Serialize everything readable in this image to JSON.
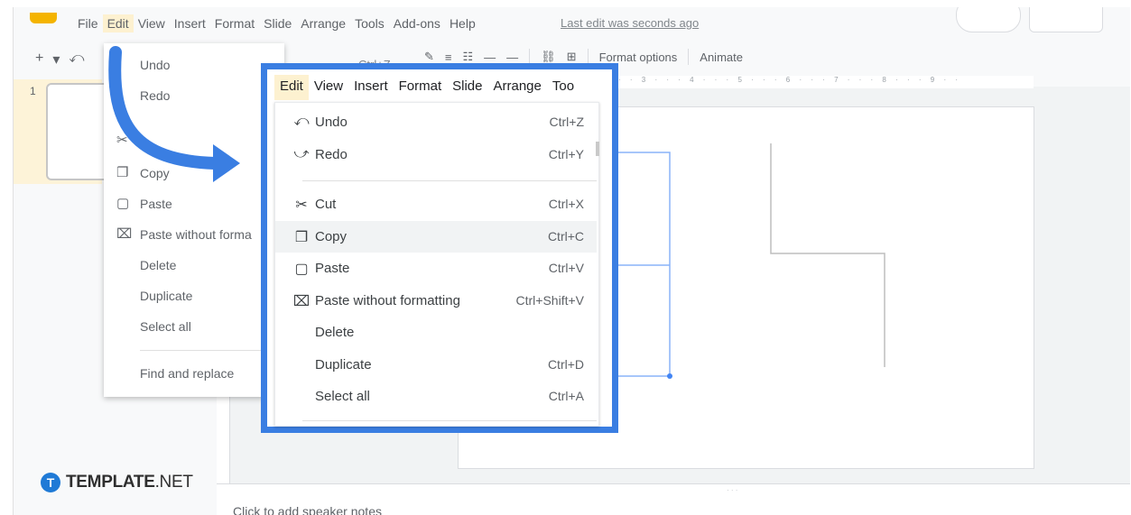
{
  "menubar": [
    "File",
    "Edit",
    "View",
    "Insert",
    "Format",
    "Slide",
    "Arrange",
    "Tools",
    "Add-ons",
    "Help"
  ],
  "last_edit": "Last edit was seconds ago",
  "toolbar": {
    "left_symbols": [
      "+",
      "▾",
      "⤺"
    ],
    "format_options": "Format options",
    "animate": "Animate"
  },
  "slide_number": "1",
  "bg_menu": {
    "undo_shortcut": "Ctrl+Z",
    "items": [
      "Undo",
      "Redo",
      "Copy",
      "Paste",
      "Paste without forma",
      "Delete",
      "Duplicate",
      "Select all",
      "Find and replace"
    ]
  },
  "zoom_menubar": [
    "Edit",
    "View",
    "Insert",
    "Format",
    "Slide",
    "Arrange",
    "Too"
  ],
  "edit_menu": [
    {
      "label": "Undo",
      "shortcut": "Ctrl+Z",
      "icon": "undo-icon"
    },
    {
      "label": "Redo",
      "shortcut": "Ctrl+Y",
      "icon": "redo-icon"
    },
    {
      "label": "Cut",
      "shortcut": "Ctrl+X",
      "icon": "scissors-icon"
    },
    {
      "label": "Copy",
      "shortcut": "Ctrl+C",
      "icon": "copy-icon"
    },
    {
      "label": "Paste",
      "shortcut": "Ctrl+V",
      "icon": "paste-icon"
    },
    {
      "label": "Paste without formatting",
      "shortcut": "Ctrl+Shift+V",
      "icon": "paste-plain-icon"
    },
    {
      "label": "Delete",
      "shortcut": "",
      "icon": ""
    },
    {
      "label": "Duplicate",
      "shortcut": "Ctrl+D",
      "icon": ""
    },
    {
      "label": "Select all",
      "shortcut": "Ctrl+A",
      "icon": ""
    }
  ],
  "speaker_notes": "Click to add speaker notes",
  "brand": {
    "name_bold": "TEMPLATE",
    "name_rest": ".NET",
    "badge": "T"
  },
  "colors": {
    "accent": "#3a7ee2",
    "highlight": "#fdf1d0"
  }
}
